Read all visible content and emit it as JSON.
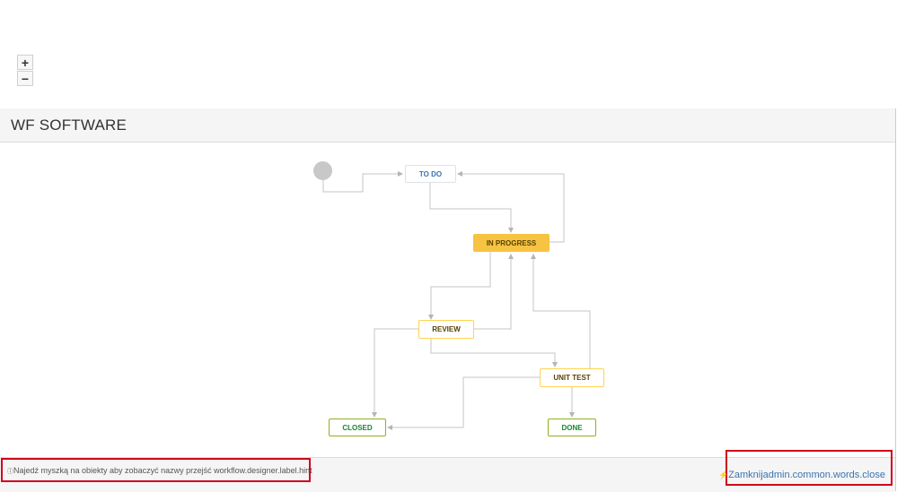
{
  "dialog": {
    "title": "WF SOFTWARE"
  },
  "zoom": {
    "in_label": "+",
    "out_label": "−"
  },
  "workflow": {
    "statuses": {
      "todo": "TO DO",
      "in_progress": "IN PROGRESS",
      "review": "REVIEW",
      "unit_test": "UNIT TEST",
      "closed": "CLOSED",
      "done": "DONE"
    }
  },
  "footer": {
    "hint_icon": "ⓘ",
    "hint": "Najedź myszką na obiekty aby zobaczyć nazwy przejść workflow.designer.label.hint",
    "close_label": "Zamknijadmin.common.words.close"
  },
  "colors": {
    "accent_link": "#3b73af",
    "in_progress": "#f6c342",
    "done_green": "#14892c",
    "highlight_red": "#d0021b"
  }
}
